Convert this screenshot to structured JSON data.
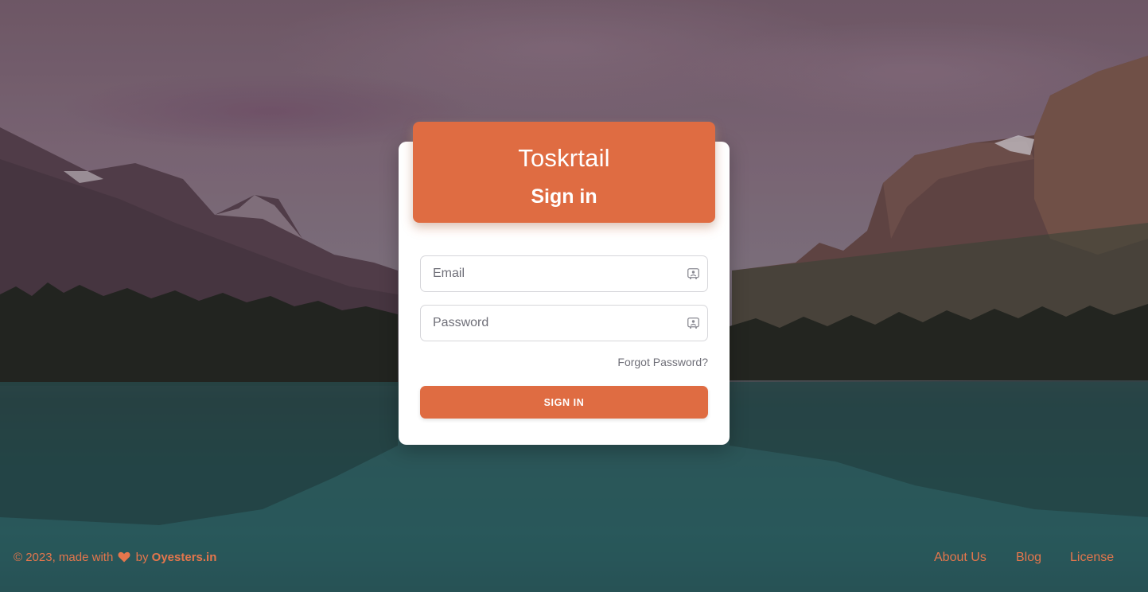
{
  "login_card": {
    "brand": "Toskrtail",
    "heading": "Sign in",
    "email": {
      "placeholder": "Email",
      "value": "",
      "icon": "id-card-icon"
    },
    "password": {
      "placeholder": "Password",
      "value": "",
      "icon": "id-card-icon"
    },
    "forgot_password": "Forgot Password?",
    "submit_label": "SIGN IN"
  },
  "footer": {
    "copyright": "© 2023, made with",
    "by": "by",
    "brand": "Oyesters.in",
    "heart_icon": "heart-icon",
    "links": [
      {
        "label": "About Us"
      },
      {
        "label": "Blog"
      },
      {
        "label": "License"
      }
    ]
  },
  "colors": {
    "accent": "#df6c42",
    "footer_text": "#e5764c",
    "card_background": "#ffffff",
    "muted_text": "#6f6f78"
  },
  "background": {
    "description_icon": "mountain-lake-background"
  }
}
